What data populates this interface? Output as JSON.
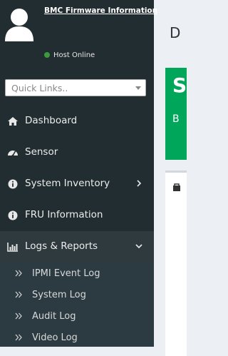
{
  "header": {
    "firmware_link": "BMC Firmware Information",
    "host_status": "Host Online"
  },
  "quick_links": {
    "placeholder": "Quick Links.."
  },
  "menu": [
    {
      "label": "Dashboard",
      "icon": "home-icon"
    },
    {
      "label": "Sensor",
      "icon": "dashboard-gauge-icon"
    },
    {
      "label": "System Inventory",
      "icon": "info-circle-icon"
    },
    {
      "label": "FRU Information",
      "icon": "info-circle-icon"
    },
    {
      "label": "Logs & Reports",
      "icon": "bar-chart-icon"
    }
  ],
  "submenu": [
    {
      "label": "IPMI Event Log"
    },
    {
      "label": "System Log"
    },
    {
      "label": "Audit Log"
    },
    {
      "label": "Video Log"
    }
  ],
  "content": {
    "title_partial": "D",
    "box_big_partial": "S",
    "box_small_partial": "B"
  },
  "colors": {
    "sidebar_bg": "#222d32",
    "active_bg": "#2f3a3f",
    "submenu_bg": "#2c3b41",
    "status_online": "#3c9a3c",
    "success_box": "#00a65a",
    "content_bg": "#ecf0f5"
  }
}
